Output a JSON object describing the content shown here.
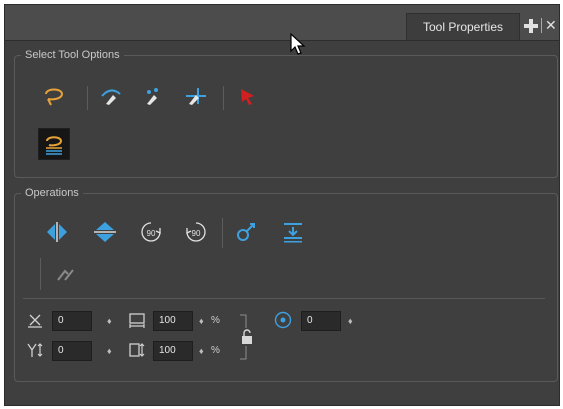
{
  "panel": {
    "tab_label": "Tool Properties",
    "tab_close": "✕"
  },
  "select_tool_options": {
    "title": "Select Tool Options",
    "tools": [
      {
        "icon": "lasso-icon",
        "state": "normal"
      },
      {
        "icon": "select-by-color-icon",
        "state": "normal"
      },
      {
        "icon": "select-by-color-2-icon",
        "state": "normal"
      },
      {
        "icon": "select-by-color-3-icon",
        "state": "normal"
      },
      {
        "icon": "red-select-arrow-icon",
        "state": "normal"
      },
      {
        "icon": "lasso-lines-icon",
        "state": "active"
      }
    ]
  },
  "operations": {
    "title": "Operations",
    "buttons": [
      "flip-horizontal-icon",
      "flip-vertical-icon",
      "rotate-90-cw-icon",
      "rotate-90-ccw-icon",
      "smooth-icon",
      "flatten-icon",
      "create-empty-drawing-icon"
    ],
    "rotate_cw_label": "90",
    "rotate_ccw_label": "90",
    "fields": {
      "offset_x": "0",
      "offset_y": "0",
      "width": "100",
      "height": "100",
      "angle": "0"
    },
    "percent_unit": "%",
    "spin_glyph": "♦"
  },
  "colors": {
    "accent_blue": "#3ea1df",
    "accent_orange": "#e8a23a",
    "panel_bg": "#3f3f3f"
  }
}
